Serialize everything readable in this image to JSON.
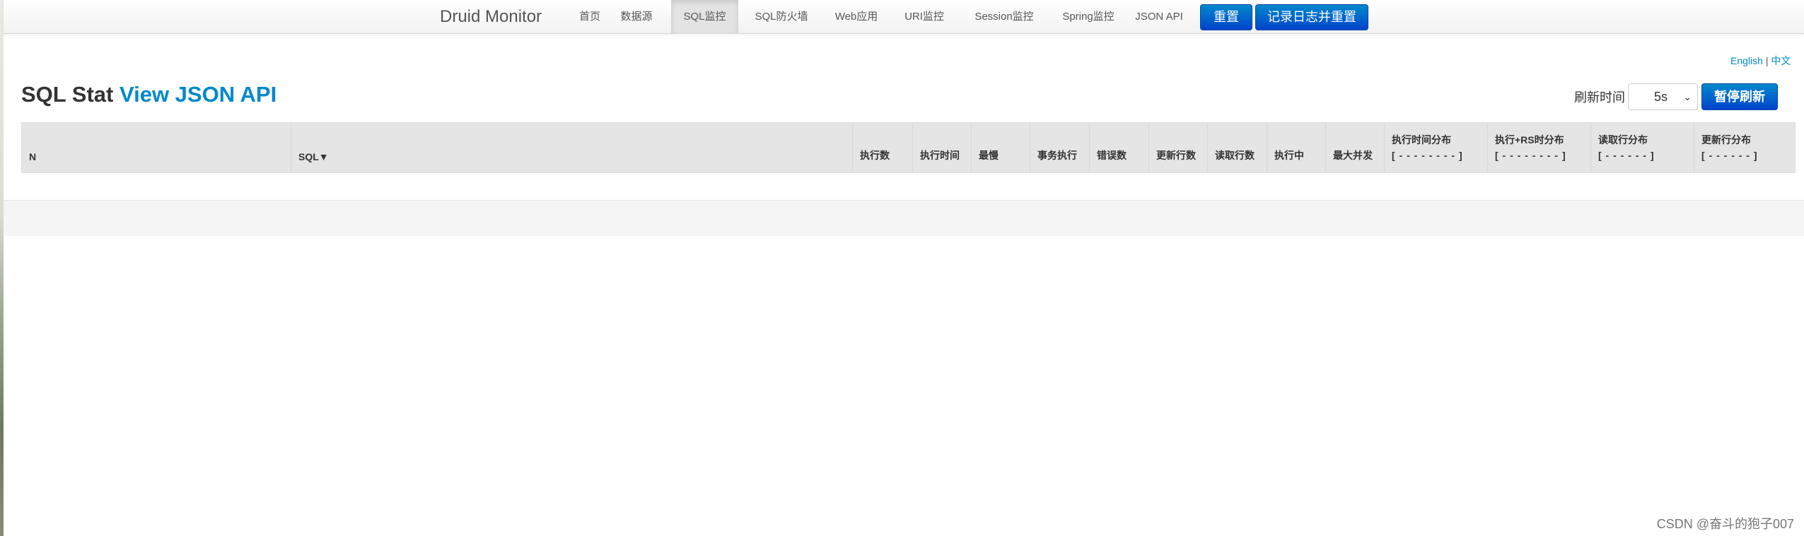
{
  "navbar": {
    "brand": "Druid Monitor",
    "items": [
      {
        "label": "首页",
        "active": false
      },
      {
        "label": "数据源",
        "active": false
      },
      {
        "label": "SQL监控",
        "active": true
      },
      {
        "label": "SQL防火墙",
        "active": false
      },
      {
        "label": "Web应用",
        "active": false
      },
      {
        "label": "URI监控",
        "active": false
      },
      {
        "label": "Session监控",
        "active": false
      },
      {
        "label": "Spring监控",
        "active": false
      },
      {
        "label": "JSON API",
        "active": false
      }
    ],
    "reset_button": "重置",
    "log_reset_button": "记录日志并重置"
  },
  "lang": {
    "english": "English",
    "separator": "|",
    "chinese": "中文"
  },
  "page": {
    "title": "SQL Stat",
    "json_link": "View JSON API"
  },
  "refresh": {
    "label": "刷新时间",
    "selected": "5s",
    "pause_button": "暂停刷新"
  },
  "table": {
    "columns": [
      {
        "label": "N"
      },
      {
        "label": "SQL▼"
      },
      {
        "label": "执行数"
      },
      {
        "label": "执行时间"
      },
      {
        "label": "最慢"
      },
      {
        "label": "事务执行"
      },
      {
        "label": "错误数"
      },
      {
        "label": "更新行数"
      },
      {
        "label": "读取行数"
      },
      {
        "label": "执行中"
      },
      {
        "label": "最大并发"
      },
      {
        "label": "执行时间分布",
        "sub": "[ - - - - - - - - ]"
      },
      {
        "label": "执行+RS时分布",
        "sub": "[ - - - - - - - - ]"
      },
      {
        "label": "读取行分布",
        "sub": "[ - - - - - - ]"
      },
      {
        "label": "更新行分布",
        "sub": "[ - - - - - - ]"
      }
    ]
  },
  "watermark": "CSDN @奋斗的狍子007",
  "colors": {
    "accent": "#0088cc",
    "button": "#0044cc",
    "header_bg": "#e5e5e5"
  }
}
